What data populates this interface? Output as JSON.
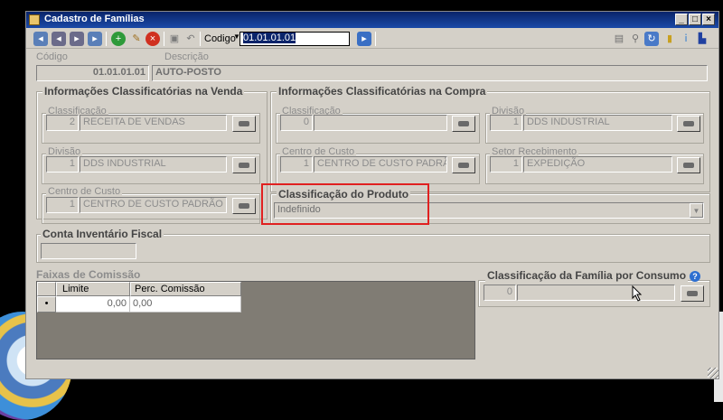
{
  "window": {
    "title": "Cadastro de Famílias",
    "controls": {
      "minimize": "_",
      "maximize": "□",
      "close": "×"
    }
  },
  "toolbar": {
    "codigo_label": "Codigo",
    "codigo_value": "01.01.01.01"
  },
  "header": {
    "codigo_label": "Código",
    "codigo_value": "01.01.01.01",
    "descricao_label": "Descrição",
    "descricao_value": "AUTO-POSTO"
  },
  "venda": {
    "title": "Informações Classificatórias na Venda",
    "classificacao": {
      "label": "Classificação",
      "code": "2",
      "text": "RECEITA DE VENDAS"
    },
    "divisao": {
      "label": "Divisão",
      "code": "1",
      "text": "DDS INDUSTRIAL"
    },
    "centro_custo": {
      "label": "Centro de Custo",
      "code": "1",
      "text": "CENTRO DE CUSTO PADRÃO"
    }
  },
  "compra": {
    "title": "Informações Classificatórias na Compra",
    "classificacao": {
      "label": "Classificação",
      "code": "0",
      "text": ""
    },
    "divisao": {
      "label": "Divisão",
      "code": "1",
      "text": "DDS INDUSTRIAL"
    },
    "centro_custo": {
      "label": "Centro de Custo",
      "code": "1",
      "text": "CENTRO DE CUSTO PADRÃ"
    },
    "setor": {
      "label": "Setor Recebimento",
      "code": "1",
      "text": "EXPEDIÇÃO"
    }
  },
  "produto": {
    "title": "Classificação do Produto",
    "value": "Indefinido",
    "highlight_color": "#e02020"
  },
  "conta": {
    "title": "Conta Inventário Fiscal",
    "value": ""
  },
  "comissao": {
    "title": "Faixas de Comissão",
    "columns": [
      "Limite",
      "Perc. Comissão"
    ],
    "rows": [
      {
        "marker": "•",
        "limite": "0,00",
        "perc": "0,00"
      }
    ]
  },
  "consumo": {
    "title": "Classificação da Família por Consumo",
    "code": "0",
    "text": "",
    "help": "?"
  }
}
